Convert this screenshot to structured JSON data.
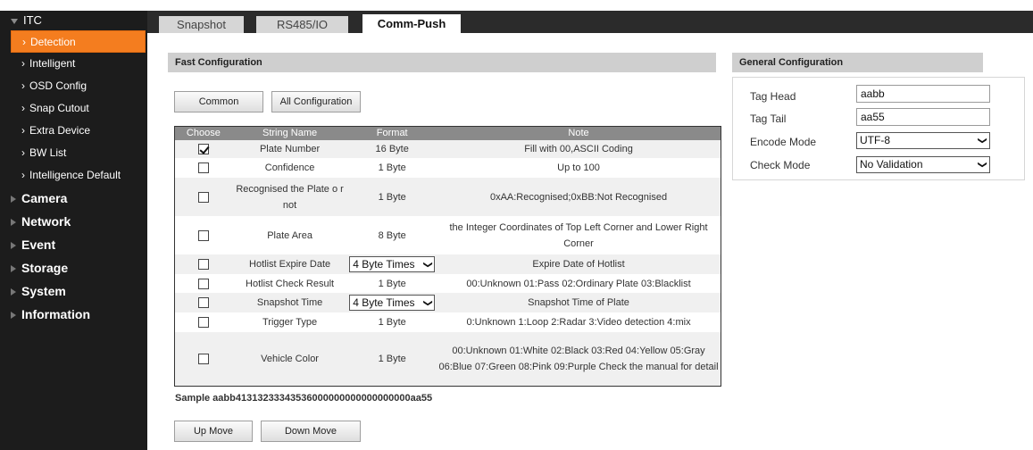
{
  "sidebar": {
    "root": "ITC",
    "items": [
      {
        "label": "Detection",
        "active": true
      },
      {
        "label": "Intelligent"
      },
      {
        "label": "OSD Config"
      },
      {
        "label": "Snap Cutout"
      },
      {
        "label": "Extra Device"
      },
      {
        "label": "BW List"
      },
      {
        "label": "Intelligence Default"
      }
    ],
    "groups": [
      "Camera",
      "Network",
      "Event",
      "Storage",
      "System",
      "Information"
    ],
    "chevron": "›"
  },
  "tabs": [
    {
      "label": "Snapshot",
      "active": false
    },
    {
      "label": "RS485/IO",
      "active": false
    },
    {
      "label": "Comm-Push",
      "active": true
    }
  ],
  "fast": {
    "header": "Fast Configuration",
    "common_button": "Common",
    "all_button": "All Configuration",
    "columns": [
      "Choose",
      "String Name",
      "Format",
      "Note"
    ],
    "rows": [
      {
        "checked": true,
        "name": "Plate Number",
        "format": "16 Byte",
        "note": "Fill with 00,ASCII Coding"
      },
      {
        "checked": false,
        "name": "Confidence",
        "format": "1 Byte",
        "note": "Up to 100"
      },
      {
        "checked": false,
        "name": "Recognised the Plate o r not",
        "format": "1 Byte",
        "note": "0xAA:Recognised;0xBB:Not Recognised"
      },
      {
        "checked": false,
        "name": "Plate Area",
        "format": "8 Byte",
        "note": "the Integer Coordinates of Top Left Corner and Lower Right Corner"
      },
      {
        "checked": false,
        "name": "Hotlist Expire Date",
        "format_select": "4 Byte Times",
        "note": "Expire Date of Hotlist"
      },
      {
        "checked": false,
        "name": "Hotlist Check Result",
        "format": "1 Byte",
        "note": "00:Unknown 01:Pass 02:Ordinary Plate 03:Blacklist"
      },
      {
        "checked": false,
        "name": "Snapshot Time",
        "format_select": "4 Byte Times",
        "note": "Snapshot Time of Plate"
      },
      {
        "checked": false,
        "name": "Trigger Type",
        "format": "1 Byte",
        "note": "0:Unknown 1:Loop 2:Radar 3:Video detection 4:mix"
      },
      {
        "checked": false,
        "name": "Vehicle Color",
        "format": "1 Byte",
        "note": "00:Unknown 01:White 02:Black 03:Red 04:Yellow 05:Gray 06:Blue 07:Green 08:Pink 09:Purple Check the manual for detail"
      }
    ],
    "sample": "Sample aabb41313233343536000000000000000000aa55",
    "up_button": "Up Move",
    "down_button": "Down Move"
  },
  "general": {
    "header": "General Configuration",
    "tag_head_label": "Tag Head",
    "tag_head_value": "aabb",
    "tag_tail_label": "Tag Tail",
    "tag_tail_value": "aa55",
    "encode_label": "Encode Mode",
    "encode_value": "UTF-8",
    "check_label": "Check Mode",
    "check_value": "No Validation"
  },
  "colors": {
    "sidebar_bg": "#1c1c1c",
    "active_item": "#f47d1f",
    "tabbar_bg": "#2b2b2b",
    "table_header": "#8a8a8a"
  }
}
